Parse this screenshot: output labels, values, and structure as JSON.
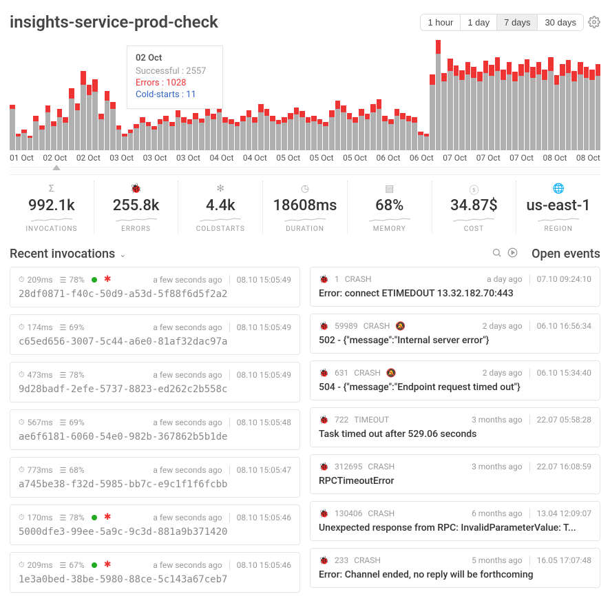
{
  "title": "insights-service-prod-check",
  "ranges": [
    "1 hour",
    "1 day",
    "7 days",
    "30 days"
  ],
  "range_active": "7 days",
  "xaxis": [
    "01 Oct",
    "02 Oct",
    "02 Oct",
    "03 Oct",
    "03 Oct",
    "03 Oct",
    "04 Oct",
    "04 Oct",
    "05 Oct",
    "05 Oct",
    "05 Oct",
    "06 Oct",
    "06 Oct",
    "07 Oct",
    "07 Oct",
    "07 Oct",
    "08 Oct",
    "08 Oct"
  ],
  "tooltip": {
    "date": "02 Oct",
    "successful_label": "Successful :",
    "successful": "2557",
    "errors_label": "Errors :",
    "errors": "1028",
    "cold_label": "Cold-starts :",
    "cold": "11"
  },
  "stats": [
    {
      "icon": "Σ",
      "value": "992.1k",
      "label": "INVOCATIONS"
    },
    {
      "icon": "bug",
      "value": "255.8k",
      "label": "ERRORS"
    },
    {
      "icon": "✻",
      "value": "4.4k",
      "label": "COLDSTARTS"
    },
    {
      "icon": "clock",
      "value": "18608ms",
      "label": "DURATION"
    },
    {
      "icon": "mem",
      "value": "68%",
      "label": "MEMORY"
    },
    {
      "icon": "$",
      "value": "34.87$",
      "label": "COST"
    },
    {
      "icon": "globe",
      "value": "us-east-1",
      "label": "REGION"
    }
  ],
  "recent_title": "Recent invocations",
  "open_title": "Open events",
  "invocations": [
    {
      "dur": "209ms",
      "mem": "78%",
      "dots": 2,
      "ago": "a few seconds ago",
      "ts": "08.10 15:05:49",
      "id": "28df0871-f40c-50d9-a53d-5f88f6d5f2a2"
    },
    {
      "dur": "174ms",
      "mem": "69%",
      "dots": 0,
      "ago": "a few seconds ago",
      "ts": "08.10 15:05:49",
      "id": "c65ed656-3007-5c44-a6e0-81af32dac97a"
    },
    {
      "dur": "473ms",
      "mem": "78%",
      "dots": 0,
      "ago": "a few seconds ago",
      "ts": "08.10 15:05:49",
      "id": "9d28badf-2efe-5737-8823-ed262c2b558c"
    },
    {
      "dur": "567ms",
      "mem": "69%",
      "dots": 0,
      "ago": "a few seconds ago",
      "ts": "08.10 15:05:48",
      "id": "ae6f6181-6060-54e0-982b-367862b5b1de"
    },
    {
      "dur": "773ms",
      "mem": "68%",
      "dots": 0,
      "ago": "a few seconds ago",
      "ts": "08.10 15:05:47",
      "id": "a745be38-f32d-5985-bb7c-e9c1f1f6fcbb"
    },
    {
      "dur": "170ms",
      "mem": "78%",
      "dots": 2,
      "ago": "a few seconds ago",
      "ts": "08.10 15:05:46",
      "id": "5000dfe3-99ee-5a9c-9c3d-881a9b371420"
    },
    {
      "dur": "209ms",
      "mem": "67%",
      "dots": 2,
      "ago": "a few seconds ago",
      "ts": "08.10 15:05:46",
      "id": "1e3a0bed-38be-5980-88ce-5c143a67ceb7"
    }
  ],
  "events": [
    {
      "count": "1",
      "kind": "CRASH",
      "bell": false,
      "ago": "a day ago",
      "ts": "07.10 09:24:10",
      "msg": "Error: connect ETIMEDOUT 13.32.182.70:443"
    },
    {
      "count": "59989",
      "kind": "CRASH",
      "bell": true,
      "ago": "2 days ago",
      "ts": "06.10 16:56:34",
      "msg": "502 - {\"message\":\"Internal server error\"}"
    },
    {
      "count": "631",
      "kind": "CRASH",
      "bell": true,
      "ago": "2 days ago",
      "ts": "06.10 15:34:40",
      "msg": "504 - {\"message\":\"Endpoint request timed out\"}"
    },
    {
      "count": "722",
      "kind": "TIMEOUT",
      "bell": false,
      "ago": "3 months ago",
      "ts": "22.07 05:58:28",
      "msg": "Task timed out after 529.06 seconds"
    },
    {
      "count": "312695",
      "kind": "CRASH",
      "bell": false,
      "ago": "3 months ago",
      "ts": "22.07 16:08:59",
      "msg": "RPCTimeoutError"
    },
    {
      "count": "130406",
      "kind": "CRASH",
      "bell": false,
      "ago": "6 months ago",
      "ts": "13.04 12:09:07",
      "msg": "Unexpected response from RPC: InvalidParameterValue: T..."
    },
    {
      "count": "233",
      "kind": "CRASH",
      "bell": false,
      "ago": "5 months ago",
      "ts": "16.05 17:07:48",
      "msg": "Error: Channel ended, no reply will be forthcoming"
    }
  ],
  "chart_data": {
    "type": "bar",
    "note": "stacked bars per time bucket over 7 days; y-axis not labeled, heights are relative 0-160px; tooltip shows example absolute values at 02 Oct",
    "series_names": [
      "errors",
      "successful"
    ],
    "bars": [
      {
        "ok": 60,
        "err": 6
      },
      {
        "ok": 20,
        "err": 4
      },
      {
        "ok": 25,
        "err": 5
      },
      {
        "ok": 18,
        "err": 3
      },
      {
        "ok": 42,
        "err": 8
      },
      {
        "ok": 30,
        "err": 6
      },
      {
        "ok": 55,
        "err": 10
      },
      {
        "ok": 35,
        "err": 7
      },
      {
        "ok": 48,
        "err": 12
      },
      {
        "ok": 40,
        "err": 8
      },
      {
        "ok": 75,
        "err": 15
      },
      {
        "ok": 58,
        "err": 10
      },
      {
        "ok": 95,
        "err": 20
      },
      {
        "ok": 80,
        "err": 15
      },
      {
        "ok": 85,
        "err": 18
      },
      {
        "ok": 45,
        "err": 8
      },
      {
        "ok": 72,
        "err": 14
      },
      {
        "ok": 60,
        "err": 10
      },
      {
        "ok": 30,
        "err": 6
      },
      {
        "ok": 20,
        "err": 4
      },
      {
        "ok": 25,
        "err": 5
      },
      {
        "ok": 32,
        "err": 6
      },
      {
        "ok": 40,
        "err": 8
      },
      {
        "ok": 35,
        "err": 6
      },
      {
        "ok": 30,
        "err": 5
      },
      {
        "ok": 38,
        "err": 7
      },
      {
        "ok": 42,
        "err": 8
      },
      {
        "ok": 35,
        "err": 6
      },
      {
        "ok": 48,
        "err": 10
      },
      {
        "ok": 40,
        "err": 8
      },
      {
        "ok": 38,
        "err": 7
      },
      {
        "ok": 45,
        "err": 9
      },
      {
        "ok": 40,
        "err": 6
      },
      {
        "ok": 50,
        "err": 10
      },
      {
        "ok": 45,
        "err": 8
      },
      {
        "ok": 55,
        "err": 12
      },
      {
        "ok": 40,
        "err": 8
      },
      {
        "ok": 38,
        "err": 7
      },
      {
        "ok": 35,
        "err": 6
      },
      {
        "ok": 42,
        "err": 8
      },
      {
        "ok": 48,
        "err": 10
      },
      {
        "ok": 40,
        "err": 8
      },
      {
        "ok": 55,
        "err": 12
      },
      {
        "ok": 50,
        "err": 10
      },
      {
        "ok": 42,
        "err": 8
      },
      {
        "ok": 38,
        "err": 6
      },
      {
        "ok": 40,
        "err": 8
      },
      {
        "ok": 45,
        "err": 9
      },
      {
        "ok": 52,
        "err": 10
      },
      {
        "ok": 48,
        "err": 9
      },
      {
        "ok": 40,
        "err": 8
      },
      {
        "ok": 42,
        "err": 8
      },
      {
        "ok": 38,
        "err": 7
      },
      {
        "ok": 35,
        "err": 6
      },
      {
        "ok": 48,
        "err": 10
      },
      {
        "ok": 60,
        "err": 12
      },
      {
        "ok": 55,
        "err": 10
      },
      {
        "ok": 45,
        "err": 9
      },
      {
        "ok": 40,
        "err": 8
      },
      {
        "ok": 50,
        "err": 10
      },
      {
        "ok": 45,
        "err": 8
      },
      {
        "ok": 55,
        "err": 12
      },
      {
        "ok": 60,
        "err": 14
      },
      {
        "ok": 42,
        "err": 8
      },
      {
        "ok": 38,
        "err": 7
      },
      {
        "ok": 50,
        "err": 10
      },
      {
        "ok": 45,
        "err": 9
      },
      {
        "ok": 42,
        "err": 8
      },
      {
        "ok": 40,
        "err": 8
      },
      {
        "ok": 22,
        "err": 5
      },
      {
        "ok": 20,
        "err": 4
      },
      {
        "ok": 95,
        "err": 15
      },
      {
        "ok": 140,
        "err": 20
      },
      {
        "ok": 100,
        "err": 12
      },
      {
        "ok": 115,
        "err": 18
      },
      {
        "ok": 108,
        "err": 15
      },
      {
        "ok": 102,
        "err": 14
      },
      {
        "ok": 110,
        "err": 18
      },
      {
        "ok": 105,
        "err": 16
      },
      {
        "ok": 100,
        "err": 14
      },
      {
        "ok": 112,
        "err": 18
      },
      {
        "ok": 108,
        "err": 16
      },
      {
        "ok": 115,
        "err": 20
      },
      {
        "ok": 102,
        "err": 15
      },
      {
        "ok": 110,
        "err": 18
      },
      {
        "ok": 100,
        "err": 14
      },
      {
        "ok": 108,
        "err": 17
      },
      {
        "ok": 113,
        "err": 19
      },
      {
        "ok": 105,
        "err": 16
      },
      {
        "ok": 110,
        "err": 18
      },
      {
        "ok": 102,
        "err": 15
      },
      {
        "ok": 115,
        "err": 20
      },
      {
        "ok": 95,
        "err": 14
      },
      {
        "ok": 108,
        "err": 17
      },
      {
        "ok": 112,
        "err": 19
      },
      {
        "ok": 100,
        "err": 15
      },
      {
        "ok": 110,
        "err": 18
      },
      {
        "ok": 105,
        "err": 16
      },
      {
        "ok": 102,
        "err": 15
      },
      {
        "ok": 108,
        "err": 17
      }
    ]
  }
}
